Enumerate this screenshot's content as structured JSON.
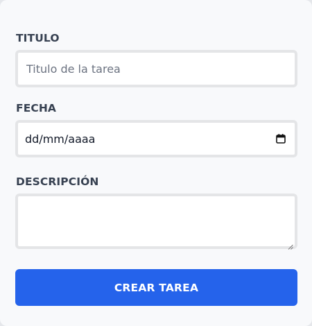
{
  "form": {
    "titulo_label": "TITULO",
    "titulo_placeholder": "Titulo de la tarea",
    "fecha_label": "FECHA",
    "fecha_value": "dd/mm/aaaa",
    "descripcion_label": "DESCRIPCIÓN",
    "descripcion_value": "",
    "submit_label": "CREAR TAREA"
  },
  "colors": {
    "accent": "#2563eb",
    "label_text": "#374151",
    "input_border": "#e4e5e7",
    "background": "#f8f9fb"
  },
  "icons": {
    "date_picker": "calendar-icon",
    "textarea_resize": "resize-handle-icon"
  }
}
